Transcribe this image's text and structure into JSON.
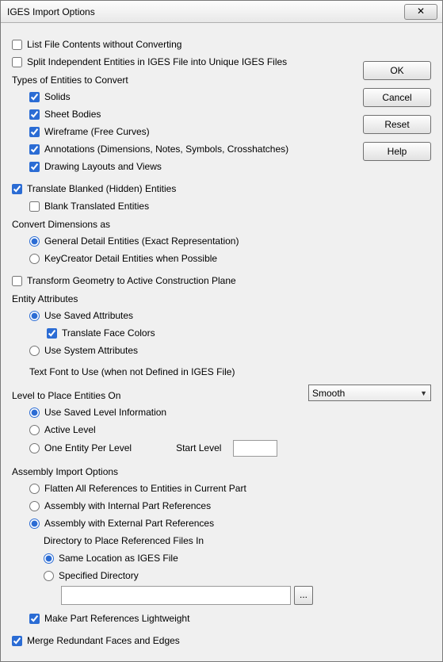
{
  "window": {
    "title": "IGES Import Options",
    "close_glyph": "✕"
  },
  "buttons": {
    "ok": "OK",
    "cancel": "Cancel",
    "reset": "Reset",
    "help": "Help",
    "browse": "..."
  },
  "labels": {
    "list_contents": "List File Contents without Converting",
    "split_entities": "Split Independent Entities in IGES File into Unique IGES Files",
    "types_header": "Types of Entities to Convert",
    "solids": "Solids",
    "sheet_bodies": "Sheet Bodies",
    "wireframe": "Wireframe (Free Curves)",
    "annotations": "Annotations (Dimensions, Notes, Symbols, Crosshatches)",
    "drawing_layouts": "Drawing Layouts and Views",
    "translate_blanked": "Translate Blanked (Hidden) Entities",
    "blank_translated": "Blank Translated Entities",
    "convert_dim_header": "Convert Dimensions as",
    "general_detail": "General Detail Entities (Exact Representation)",
    "keycreator_detail": "KeyCreator Detail Entities when Possible",
    "transform_geom": "Transform Geometry to Active Construction Plane",
    "entity_attr_header": "Entity Attributes",
    "use_saved_attr": "Use Saved Attributes",
    "translate_face_colors": "Translate Face Colors",
    "use_system_attr": "Use System Attributes",
    "text_font": "Text Font to Use (when not Defined in IGES File)",
    "font_value": "Smooth",
    "level_header": "Level to Place Entities On",
    "use_saved_level": "Use Saved Level Information",
    "active_level": "Active Level",
    "one_entity_per_level": "One Entity Per Level",
    "start_level": "Start Level",
    "start_level_value": "",
    "asm_header": "Assembly Import Options",
    "flatten": "Flatten All References to Entities in Current Part",
    "asm_internal": "Assembly with Internal Part References",
    "asm_external": "Assembly with External Part References",
    "dir_label": "Directory to Place Referenced Files In",
    "same_location": "Same Location as IGES File",
    "specified_dir": "Specified Directory",
    "specified_dir_value": "",
    "lightweight": "Make Part References Lightweight",
    "merge_faces": "Merge Redundant Faces and Edges"
  }
}
